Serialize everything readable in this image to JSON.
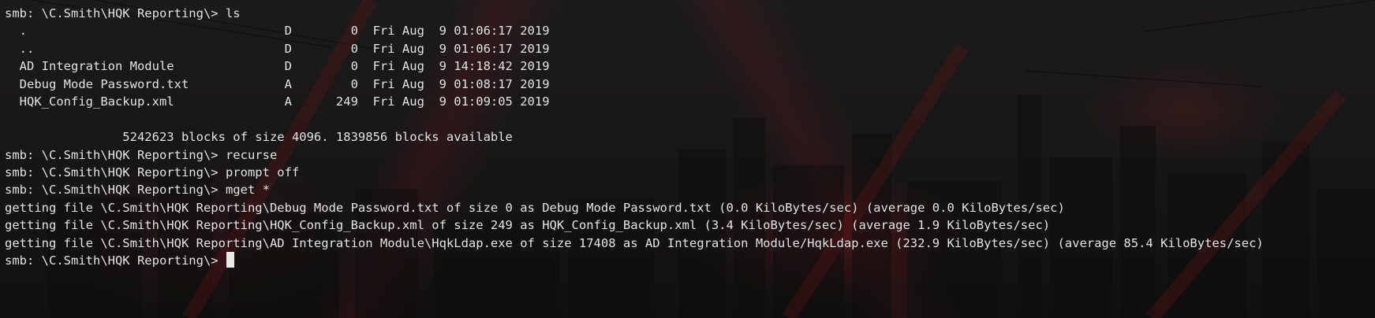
{
  "terminal": {
    "prompt": "smb: \\C.Smith\\HQK Reporting\\>",
    "lines": [
      "smb: \\C.Smith\\HQK Reporting\\> ls",
      "  .                                   D        0  Fri Aug  9 01:06:17 2019",
      "  ..                                  D        0  Fri Aug  9 01:06:17 2019",
      "  AD Integration Module               D        0  Fri Aug  9 14:18:42 2019",
      "  Debug Mode Password.txt             A        0  Fri Aug  9 01:08:17 2019",
      "  HQK_Config_Backup.xml               A      249  Fri Aug  9 01:09:05 2019",
      "",
      "                5242623 blocks of size 4096. 1839856 blocks available",
      "smb: \\C.Smith\\HQK Reporting\\> recurse",
      "smb: \\C.Smith\\HQK Reporting\\> prompt off",
      "smb: \\C.Smith\\HQK Reporting\\> mget *",
      "getting file \\C.Smith\\HQK Reporting\\Debug Mode Password.txt of size 0 as Debug Mode Password.txt (0.0 KiloBytes/sec) (average 0.0 KiloBytes/sec)",
      "getting file \\C.Smith\\HQK Reporting\\HQK_Config_Backup.xml of size 249 as HQK_Config_Backup.xml (3.4 KiloBytes/sec) (average 1.9 KiloBytes/sec)",
      "getting file \\C.Smith\\HQK Reporting\\AD Integration Module\\HqkLdap.exe of size 17408 as AD Integration Module/HqkLdap.exe (232.9 KiloBytes/sec) (average 85.4 KiloBytes/sec)"
    ],
    "colors": {
      "text": "#e6e6e6",
      "cursor": "#e8e8e8",
      "background": "#151414"
    }
  }
}
